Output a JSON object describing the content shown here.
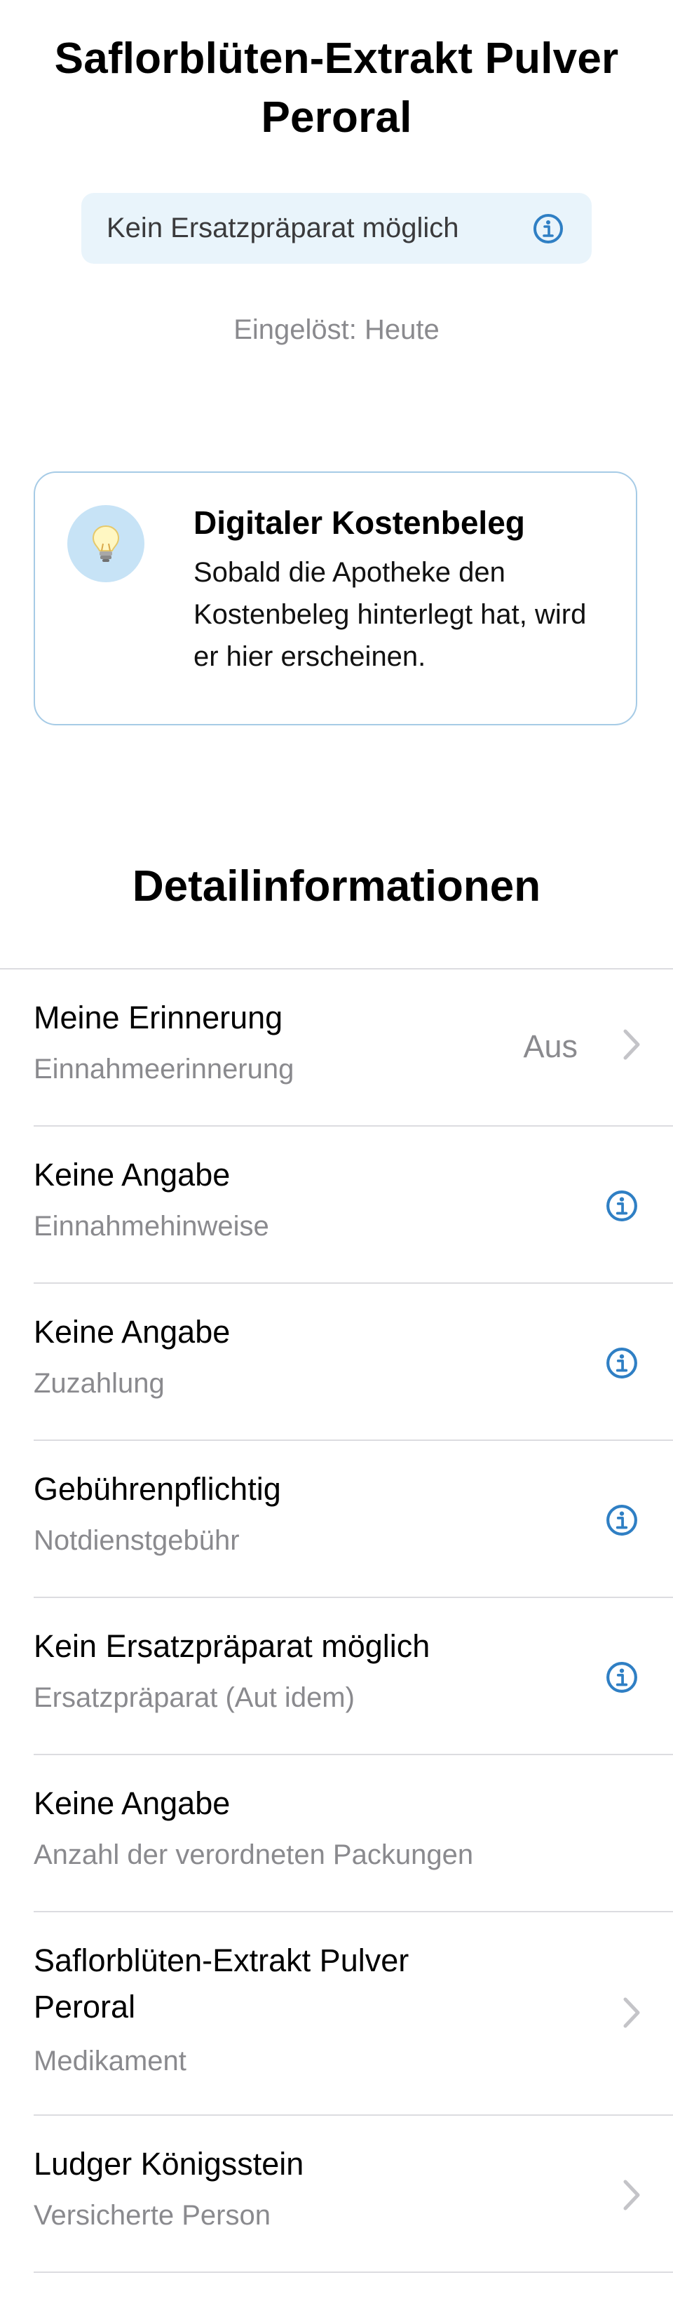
{
  "header": {
    "title_line1": "Saflorblüten-Extrakt Pulver",
    "title_line2": "Peroral"
  },
  "substitution_badge": {
    "label": "Kein Ersatzpräparat möglich",
    "icon": "info-icon"
  },
  "redeemed_label": "Eingelöst: Heute",
  "cost_receipt": {
    "icon": "light-bulb-icon",
    "title": "Digitaler Kostenbeleg",
    "body": "Sobald die Apotheke den Kostenbeleg hinterlegt hat, wird er hier erscheinen."
  },
  "details": {
    "title": "Detailinformationen",
    "rows": [
      {
        "primary": "Meine Erinnerung",
        "secondary": "Einnahmeerinnerung",
        "value": "Aus",
        "accessory": "chevron-right-icon"
      },
      {
        "primary": "Keine Angabe",
        "secondary": "Einnahmehinweise",
        "accessory": "info-icon"
      },
      {
        "primary": "Keine Angabe",
        "secondary": "Zuzahlung",
        "accessory": "info-icon"
      },
      {
        "primary": "Gebührenpflichtig",
        "secondary": "Notdienstgebühr",
        "accessory": "info-icon"
      },
      {
        "primary": "Kein Ersatzpräparat möglich",
        "secondary": "Ersatzpräparat (Aut idem)",
        "accessory": "info-icon"
      },
      {
        "primary": "Keine Angabe",
        "secondary": "Anzahl der verordneten Packungen"
      },
      {
        "primary_line1": "Saflorblüten-Extrakt Pulver",
        "primary_line2": "Peroral",
        "secondary": "Medikament",
        "accessory": "chevron-right-icon"
      },
      {
        "primary": "Ludger Königsstein",
        "secondary": "Versicherte Person",
        "accessory": "chevron-right-icon"
      }
    ]
  },
  "colors": {
    "accent_blue": "#2f7fc4",
    "badge_bg": "#e9f4fb",
    "card_border": "#a6cbe6",
    "secondary_text": "#8a8a8e",
    "divider": "#dcdce0"
  }
}
